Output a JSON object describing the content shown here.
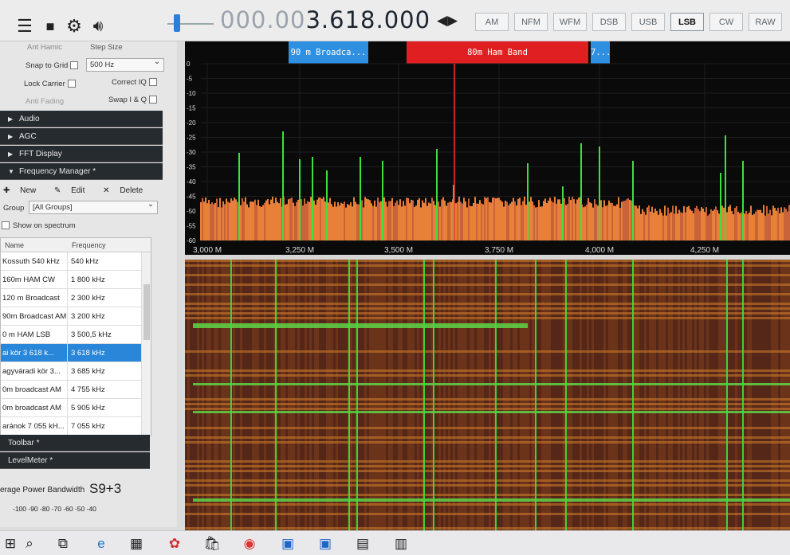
{
  "toolbar": {
    "menu_icon": "hamburger-icon",
    "stop_icon": "stop-icon",
    "settings_icon": "gear-icon",
    "audio_icon": "speaker-icon",
    "frequency_dim": "000.00",
    "frequency_main": "3.618.000",
    "freq_arrows": "◀▶",
    "modes": [
      "AM",
      "NFM",
      "WFM",
      "DSB",
      "USB",
      "LSB",
      "CW",
      "RAW"
    ],
    "active_mode": "LSB"
  },
  "left_panel": {
    "step_label_a": "Ant Hamic",
    "step_label_b": "Step Size",
    "snap_label": "Snap to Grid",
    "snap_value": "500 Hz",
    "lock_label": "Lock Carrier",
    "correct_label": "Correct IQ",
    "anti_label": "Anti Fading",
    "swap_label": "Swap I & Q",
    "sections": [
      "Audio",
      "AGC",
      "FFT Display",
      "Frequency Manager *"
    ],
    "fm_new": "New",
    "fm_edit": "Edit",
    "fm_delete": "Delete",
    "group_label": "Group",
    "group_value": "[All Groups]",
    "show_label": "Show on spectrum",
    "table_headers": [
      "Name",
      "Frequency"
    ],
    "rows": [
      {
        "name": "Kossuth 540 kHz",
        "freq": "540 kHz"
      },
      {
        "name": "160m HAM CW",
        "freq": "1 800 kHz"
      },
      {
        "name": "120 m Broadcast",
        "freq": "2 300 kHz"
      },
      {
        "name": "90m Broadcast AM",
        "freq": "3 200 kHz"
      },
      {
        "name": "0 m HAM LSB",
        "freq": "3 500,5 kHz"
      },
      {
        "name": "ai kör 3 618 k...",
        "freq": "3 618 kHz"
      },
      {
        "name": "agyváradi kör 3...",
        "freq": "3 685 kHz"
      },
      {
        "name": "0m broadcast AM",
        "freq": "4 755 kHz"
      },
      {
        "name": "0m broadcast AM",
        "freq": "5 905 kHz"
      },
      {
        "name": "aránok 7 055 kH...",
        "freq": "7 055 kHz"
      }
    ],
    "toolbar_section": "Toolbar *",
    "levelmeter_section": "LevelMeter *",
    "avg_label": "erage Power Bandwidth",
    "signal_value": "S9+3",
    "meter_ticks": "-100  -90  -80  -70  -60  -50  -40"
  },
  "spectrum": {
    "bands": [
      {
        "label": "90 m Broadca...",
        "color": "#2f8fe0"
      },
      {
        "label": "80m Ham Band",
        "color": "#e02020"
      },
      {
        "label": "7...",
        "color": "#2f8fe0"
      }
    ],
    "y_ticks": [
      "0",
      "-5",
      "-10",
      "-15",
      "-20",
      "-25",
      "-30",
      "-35",
      "-40",
      "-45",
      "-50",
      "-55",
      "-60"
    ],
    "x_ticks": [
      "3,000 M",
      "3,250 M",
      "3,500 M",
      "3,750 M",
      "4,000 M",
      "4,250 M"
    ]
  },
  "taskbar": {
    "icons": [
      "windows-icon",
      "search-icon",
      "task-view-icon",
      "edge-icon",
      "calculator-icon",
      "paint-icon",
      "store-icon",
      "chrome-icon",
      "save-icon",
      "sdr-icon",
      "app-icon",
      "app-icon-2"
    ]
  },
  "colors": {
    "accent": "#2a86d9",
    "spectrum_bg": "#0a0a0a",
    "fft_orange": "#f0883c",
    "signal_green": "#3ee03e",
    "waterfall_bg": "#4a2418"
  }
}
